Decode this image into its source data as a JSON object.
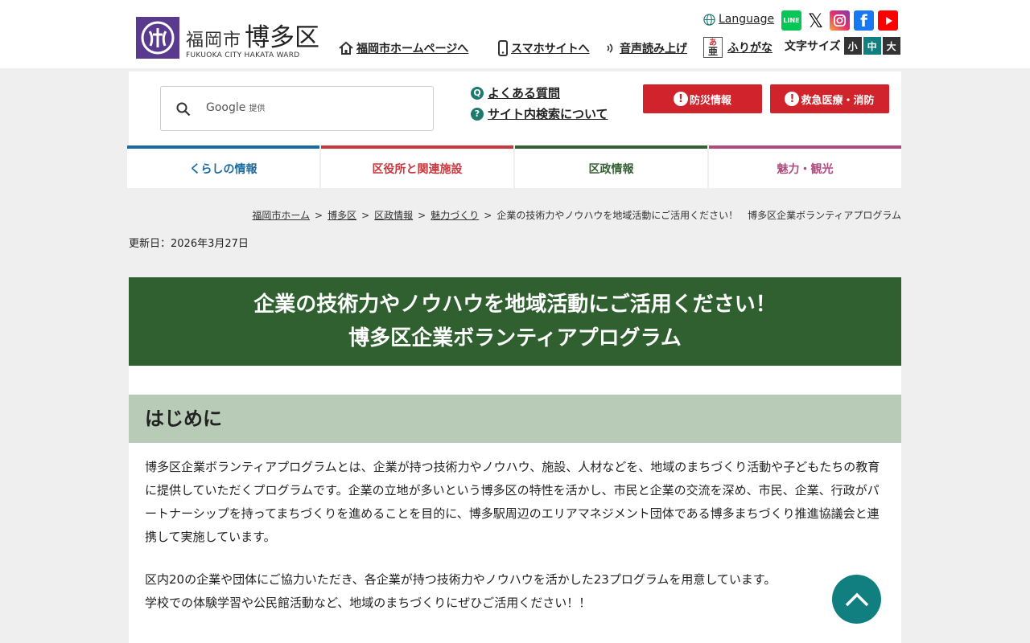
{
  "header": {
    "logo_city": "福岡市",
    "logo_ward": "博多区",
    "logo_en": "FUKUOKA CITY HAKATA WARD",
    "language": "Language",
    "sns": [
      "line-icon",
      "x-icon",
      "instagram-icon",
      "facebook-icon",
      "youtube-icon"
    ],
    "links": {
      "home": "福岡市ホームページへ",
      "mobile": "スマホサイトへ",
      "voice": "音声読み上げ",
      "furigana": "ふりがな"
    },
    "font_size": {
      "label": "文字サイズ",
      "small": "小",
      "medium": "中",
      "large": "大"
    }
  },
  "search": {
    "provider": "Google",
    "provided_by": "提供",
    "faq": "よくある質問",
    "about_search": "サイト内検索について"
  },
  "alerts": {
    "disaster": "防災情報",
    "emergency": "救急医療・消防"
  },
  "nav": [
    {
      "label": "くらしの情報",
      "color": "#1a6aa0"
    },
    {
      "label": "区役所と関連施設",
      "color": "#c8383e"
    },
    {
      "label": "区政情報",
      "color": "#356034"
    },
    {
      "label": "魅力・観光",
      "color": "#b04a7e"
    }
  ],
  "breadcrumb": {
    "items": [
      "福岡市ホーム",
      "博多区",
      "区政情報",
      "魅力づくり"
    ],
    "current": "企業の技術力やノウハウを地域活動にご活用ください！　博多区企業ボランティアプログラム"
  },
  "updated": "更新日：2026年3月27日",
  "title": {
    "line1": "企業の技術力やノウハウを地域活動にご活用ください！",
    "line2": "博多区企業ボランティアプログラム"
  },
  "section": {
    "heading": "はじめに",
    "para1": "博多区企業ボランティアプログラムとは、企業が持つ技術力やノウハウ、施設、人材などを、地域のまちづくり活動や子どもたちの教育に提供していただくプログラムです。企業の立地が多いという博多区の特性を活かし、市民と企業の交流を深め、市民、企業、行政がパートナーシップを持ってまちづくりを進めることを目的に、博多駅周辺のエリアマネジメント団体である博多まちづくり推進協議会と連携して実施しています。",
    "para2_line1": "区内20の企業や団体にご協力いただき、各企業が持つ技術力やノウハウを活かした23プログラムを用意しています。",
    "para2_line2": "学校での体験学習や公民館活動など、地域のまちづくりにぜひご活用ください！！"
  },
  "colors": {
    "title_bg": "#306030",
    "heading_bg": "#b7cbb7",
    "alert_red": "#d0232b",
    "accent_teal": "#117f7f"
  }
}
